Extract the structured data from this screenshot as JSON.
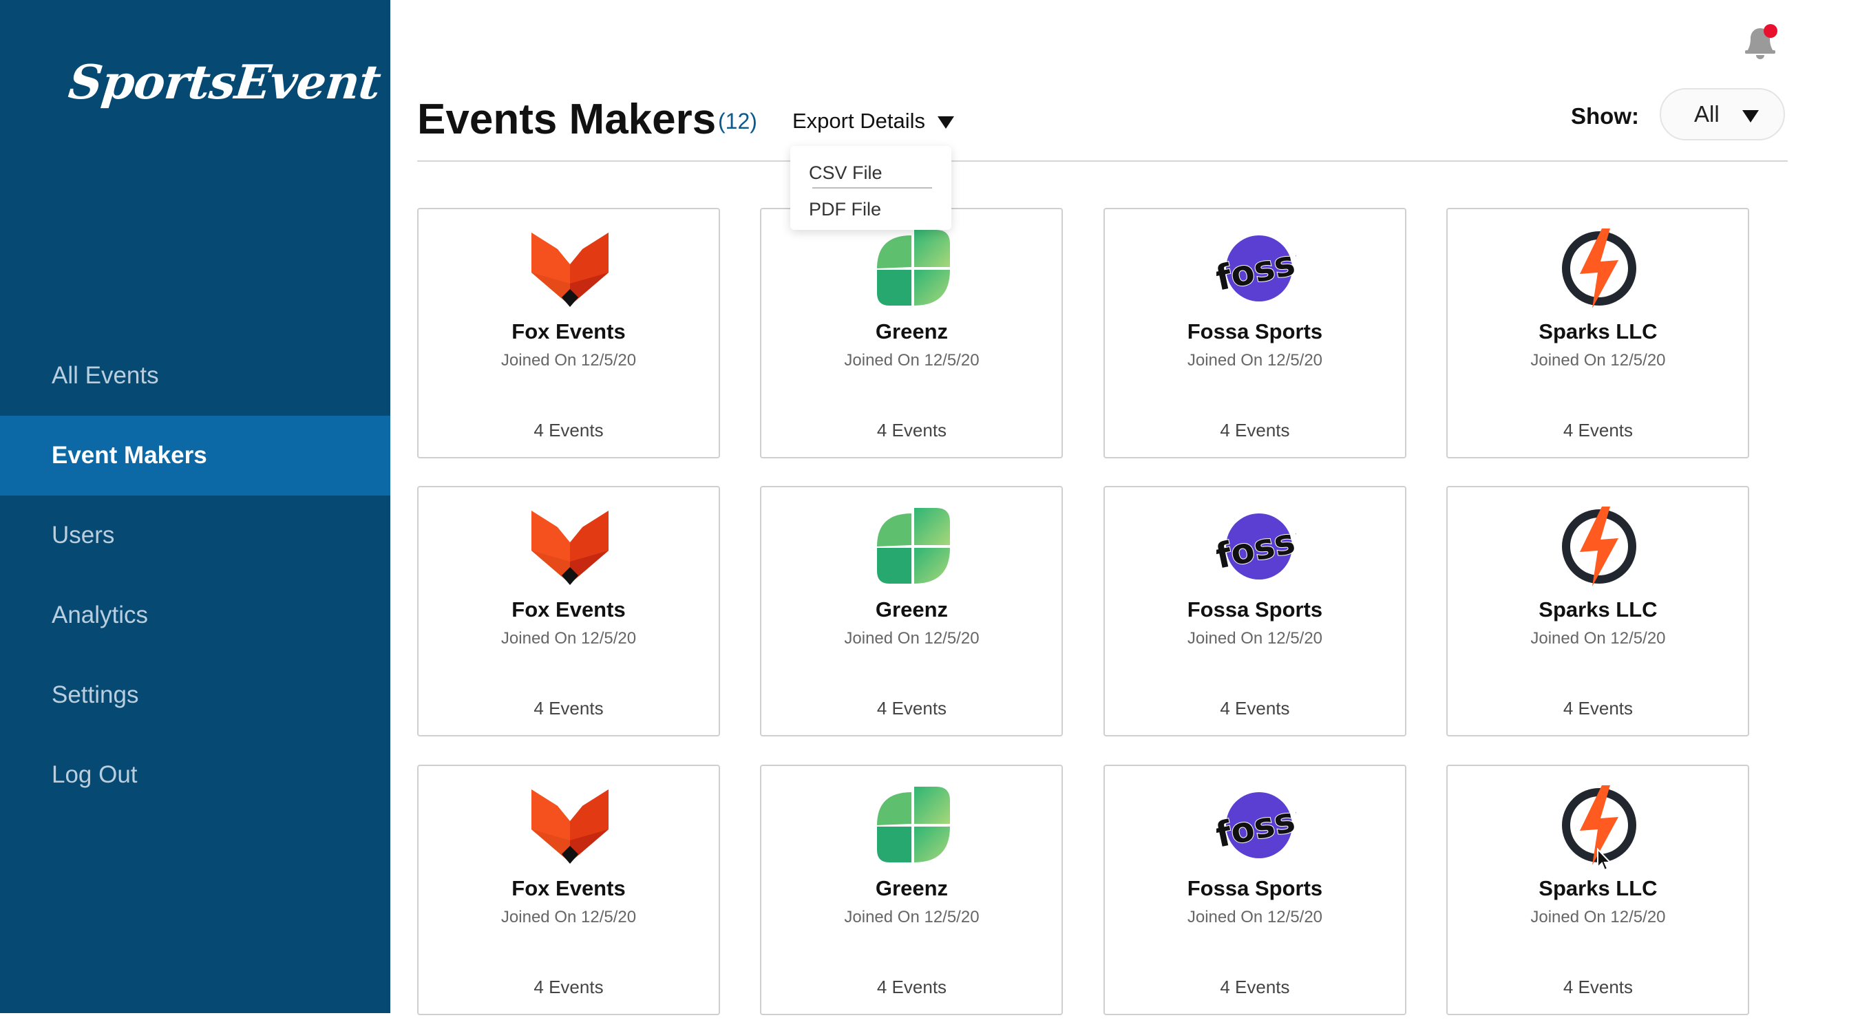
{
  "app": {
    "logo_text": "SportsEvent"
  },
  "sidebar": {
    "items": [
      {
        "label": "All Events",
        "active": false
      },
      {
        "label": "Event Makers",
        "active": true
      },
      {
        "label": "Users",
        "active": false
      },
      {
        "label": "Analytics",
        "active": false
      },
      {
        "label": "Settings",
        "active": false
      },
      {
        "label": "Log Out",
        "active": false
      }
    ]
  },
  "header": {
    "title": "Events Makers",
    "count": "(12)",
    "export_label": "Export Details",
    "export_options": [
      "CSV File",
      "PDF File"
    ],
    "show_label": "Show:",
    "show_value": "All",
    "notification_dot_color": "#e8102e"
  },
  "colors": {
    "sidebar_bg": "#064a73",
    "sidebar_active": "#0c69a6"
  },
  "cards": [
    {
      "name": "Fox Events",
      "joined": "Joined On 12/5/20",
      "events": "4 Events",
      "logo": "fox-logo-icon"
    },
    {
      "name": "Greenz",
      "joined": "Joined On 12/5/20",
      "events": "4 Events",
      "logo": "clover-logo-icon"
    },
    {
      "name": "Fossa Sports",
      "joined": "Joined On 12/5/20",
      "events": "4 Events",
      "logo": "fossa-logo-icon"
    },
    {
      "name": "Sparks LLC",
      "joined": "Joined On 12/5/20",
      "events": "4 Events",
      "logo": "spark-logo-icon"
    },
    {
      "name": "Fox Events",
      "joined": "Joined On 12/5/20",
      "events": "4 Events",
      "logo": "fox-logo-icon"
    },
    {
      "name": "Greenz",
      "joined": "Joined On 12/5/20",
      "events": "4 Events",
      "logo": "clover-logo-icon"
    },
    {
      "name": "Fossa Sports",
      "joined": "Joined On 12/5/20",
      "events": "4 Events",
      "logo": "fossa-logo-icon"
    },
    {
      "name": "Sparks LLC",
      "joined": "Joined On 12/5/20",
      "events": "4 Events",
      "logo": "spark-logo-icon"
    },
    {
      "name": "Fox Events",
      "joined": "Joined On 12/5/20",
      "events": "4 Events",
      "logo": "fox-logo-icon"
    },
    {
      "name": "Greenz",
      "joined": "Joined On 12/5/20",
      "events": "4 Events",
      "logo": "clover-logo-icon"
    },
    {
      "name": "Fossa Sports",
      "joined": "Joined On 12/5/20",
      "events": "4 Events",
      "logo": "fossa-logo-icon"
    },
    {
      "name": "Sparks LLC",
      "joined": "Joined On 12/5/20",
      "events": "4 Events",
      "logo": "spark-logo-icon"
    }
  ]
}
